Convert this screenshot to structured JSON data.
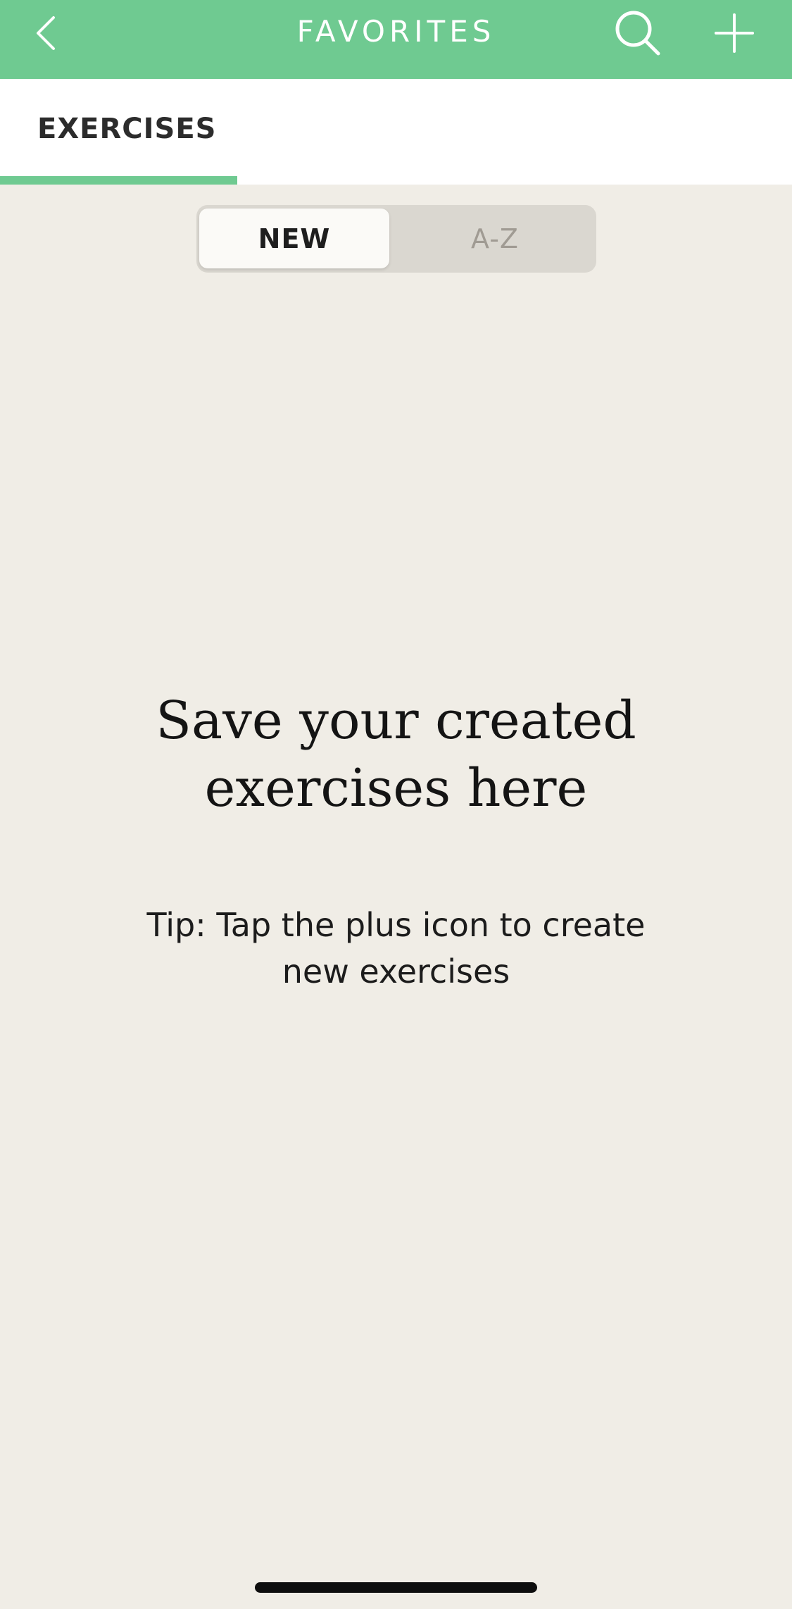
{
  "header": {
    "title": "FAVORITES",
    "back_icon": "chevron-left-icon",
    "search_icon": "search-icon",
    "add_icon": "plus-icon",
    "background_color": "#6fca91"
  },
  "tabs": [
    {
      "label": "EXERCISES",
      "active": true
    }
  ],
  "sort_toggle": {
    "options": [
      "NEW",
      "A-Z"
    ],
    "selected": "NEW"
  },
  "empty_state": {
    "title": "Save your created exercises here",
    "tip": "Tip: Tap the plus icon to create new exercises"
  }
}
